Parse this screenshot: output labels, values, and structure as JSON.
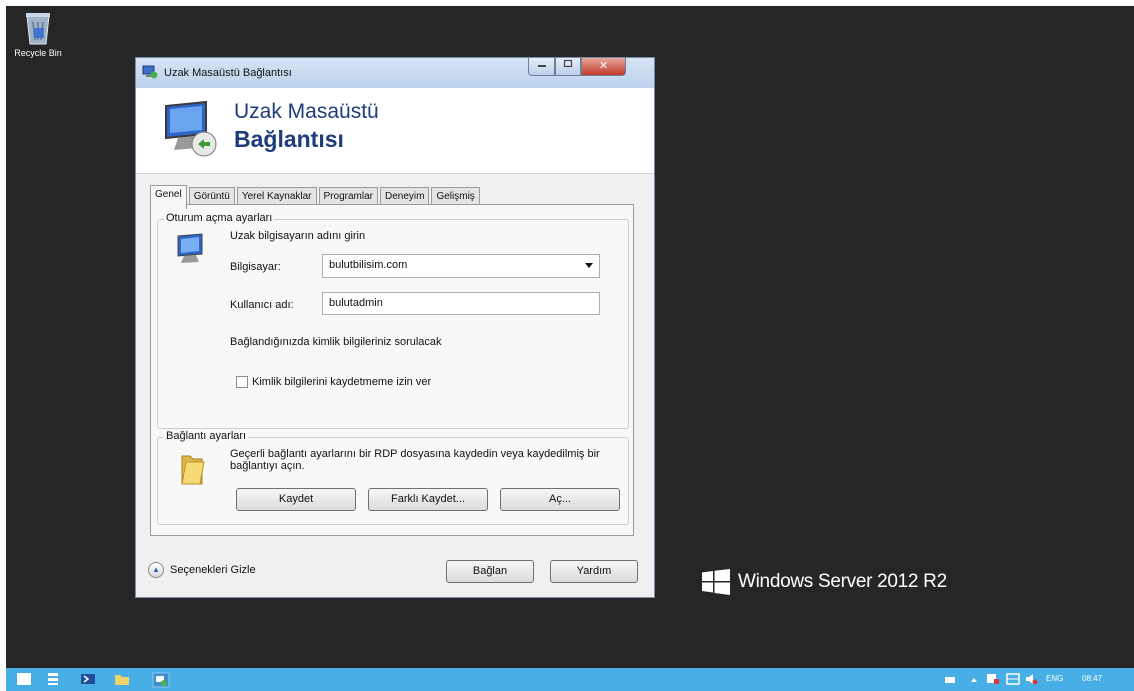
{
  "desktop": {
    "recycle_bin_label": "Recycle Bin",
    "brand_text": "Windows Server 2012 R2"
  },
  "dialog": {
    "window_title": "Uzak Masaüstü Bağlantısı",
    "close_symbol": "✕",
    "banner_line1": "Uzak Masaüstü",
    "banner_line2": "Bağlantısı",
    "tabs": [
      "Genel",
      "Görüntü",
      "Yerel Kaynaklar",
      "Programlar",
      "Deneyim",
      "Gelişmiş"
    ],
    "active_tab": "Genel",
    "logon_settings": {
      "group_title": "Oturum açma ayarları",
      "intro": "Uzak bilgisayarın adını girin",
      "computer_label": "Bilgisayar:",
      "computer_value": "bulutbilisim.com",
      "username_label": "Kullanıcı adı:",
      "username_value": "bulutadmin",
      "credentials_note": "Bağlandığınızda kimlik bilgileriniz sorulacak",
      "save_credentials_label": "Kimlik bilgilerini kaydetmeme izin ver",
      "save_credentials_checked": false
    },
    "connection_settings": {
      "group_title": "Bağlantı ayarları",
      "description": "Geçerli bağlantı ayarlarını bir RDP dosyasına kaydedin veya kaydedilmiş bir bağlantıyı açın.",
      "save_button": "Kaydet",
      "save_as_button": "Farklı Kaydet...",
      "open_button": "Aç..."
    },
    "hide_options_label": "Seçenekleri Gizle",
    "connect_button": "Bağlan",
    "help_button": "Yardım"
  },
  "taskbar": {
    "language": "ENG",
    "time": "08:47"
  },
  "colors": {
    "desktop_bg": "#262626",
    "taskbar": "#48aee6",
    "banner_text": "#1f3c7a"
  }
}
